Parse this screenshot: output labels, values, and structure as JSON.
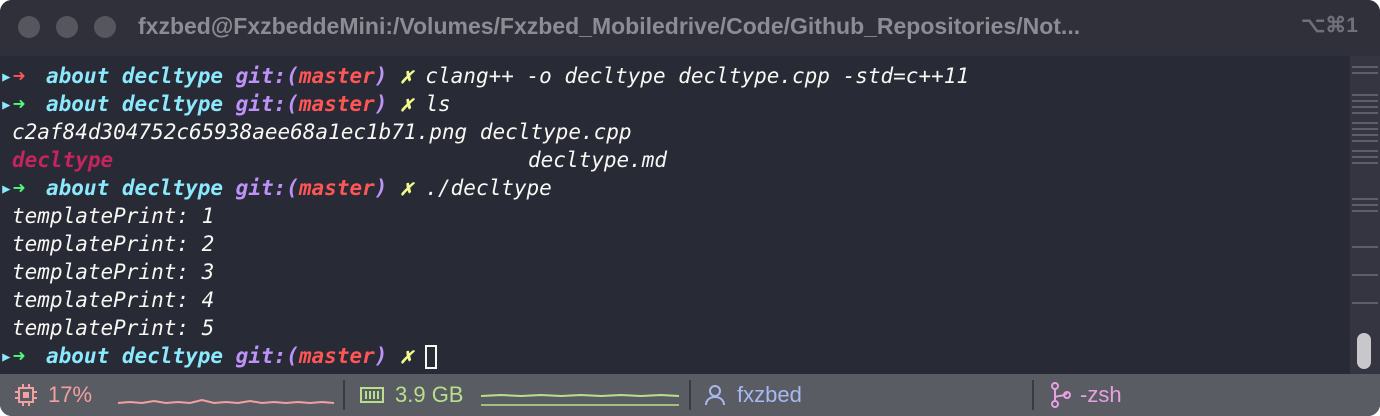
{
  "window": {
    "title": "fxzbed@FxzbeddeMini:/Volumes/Fxzbed_Mobiledrive/Code/Github_Repositories/Not...",
    "shortcut": "⌥⌘1"
  },
  "prompt": {
    "arrow": "➜",
    "dir": "about decltype",
    "git": "git:(",
    "branch": "master",
    "git_close": ")",
    "dirty": "✗"
  },
  "commands": {
    "c1": "clang++ -o decltype decltype.cpp -std=c++11",
    "c2": "ls",
    "c3": "./decltype"
  },
  "ls_output": {
    "f1": "c2af84d304752c65938aee68a1ec1b71.png",
    "f2": "decltype.cpp",
    "f3": "decltype",
    "f4": "decltype.md"
  },
  "program_output": [
    "templatePrint: 1",
    "templatePrint: 2",
    "templatePrint: 3",
    "templatePrint: 4",
    "templatePrint: 5"
  ],
  "statusbar": {
    "cpu": "17%",
    "memory": "3.9 GB",
    "user": "fxzbed",
    "shell": "-zsh"
  },
  "colors": {
    "background": "#282a36",
    "status_bar": "#5a5c63",
    "cpu_accent": "#f2a0a0",
    "memory_accent": "#b8e08a",
    "user_accent": "#a8b8f0",
    "shell_accent": "#e8a0e0"
  },
  "icons": {
    "cpu": "cpu-icon",
    "memory": "memory-icon",
    "user": "user-icon",
    "shell": "git-branch-icon"
  }
}
